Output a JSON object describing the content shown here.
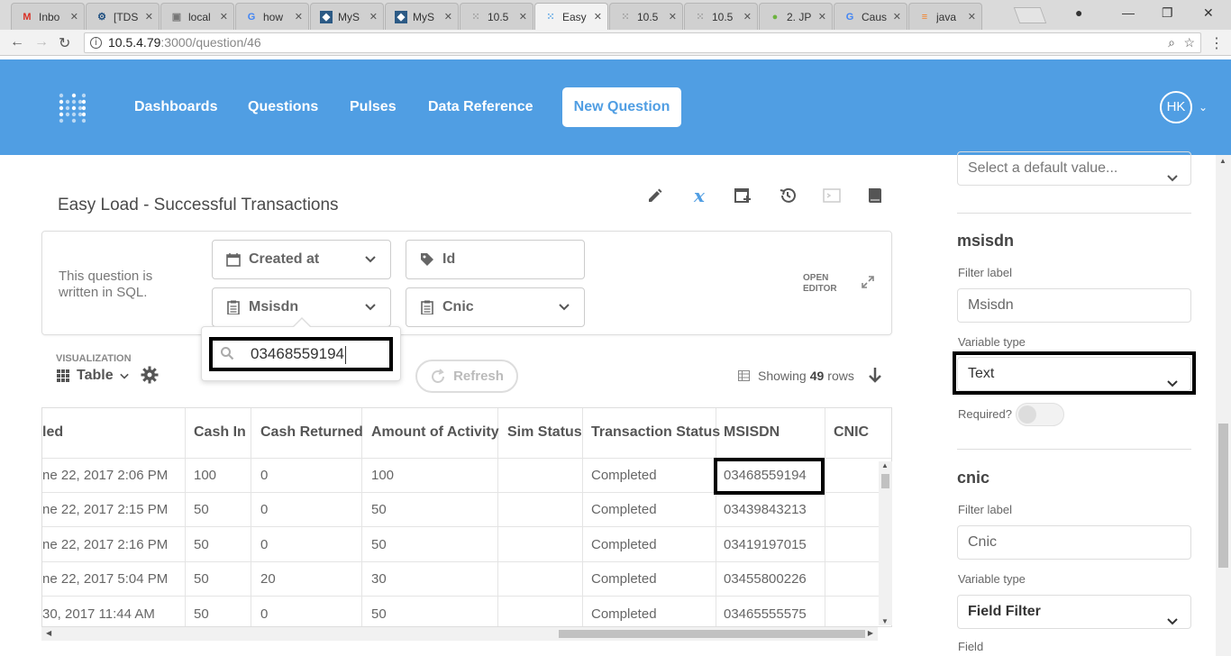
{
  "browser": {
    "tabs": [
      {
        "label": "Inbo",
        "icon": "gmail-icon"
      },
      {
        "label": "[TDS",
        "icon": "jira-icon"
      },
      {
        "label": "local",
        "icon": "xampp-icon"
      },
      {
        "label": "how",
        "icon": "google-icon"
      },
      {
        "label": "MyS",
        "icon": "mysql-icon"
      },
      {
        "label": "MyS",
        "icon": "mysql-icon"
      },
      {
        "label": "10.5",
        "icon": "metabase-icon"
      },
      {
        "label": "Easy",
        "icon": "metabase-icon"
      },
      {
        "label": "10.5",
        "icon": "metabase-icon"
      },
      {
        "label": "10.5",
        "icon": "metabase-icon"
      },
      {
        "label": "2. JP",
        "icon": "spring-icon"
      },
      {
        "label": "Caus",
        "icon": "google-icon"
      },
      {
        "label": "java",
        "icon": "stackoverflow-icon"
      }
    ],
    "url_host": "10.5.4.79",
    "url_path": ":3000/question/46"
  },
  "nav": {
    "links": [
      "Dashboards",
      "Questions",
      "Pulses",
      "Data Reference"
    ],
    "new_question": "New Question",
    "avatar_initials": "HK",
    "brand_color": "#509ee3"
  },
  "question": {
    "title": "Easy Load - Successful Transactions",
    "sql_note": "This question is written in SQL.",
    "open_editor": "OPEN EDITOR"
  },
  "filters": {
    "created_at": "Created at",
    "id": "Id",
    "msisdn": "Msisdn",
    "cnic": "Cnic"
  },
  "popover": {
    "value": "03468559194"
  },
  "viz": {
    "label": "VISUALIZATION",
    "type": "Table",
    "refresh": "Refresh",
    "showing_prefix": "Showing",
    "showing_count": "49",
    "showing_suffix": "rows"
  },
  "table": {
    "headers": [
      "led",
      "Cash In",
      "Cash Returned",
      "Amount of Activity",
      "Sim Status",
      "Transaction Status",
      "MSISDN",
      "CNIC"
    ],
    "rows": [
      [
        "ne 22, 2017 2:06 PM",
        "100",
        "0",
        "100",
        "",
        "Completed",
        "03468559194",
        ""
      ],
      [
        "ne 22, 2017 2:15 PM",
        "50",
        "0",
        "50",
        "",
        "Completed",
        "03439843213",
        ""
      ],
      [
        "ne 22, 2017 2:16 PM",
        "50",
        "0",
        "50",
        "",
        "Completed",
        "03419197015",
        ""
      ],
      [
        "ne 22, 2017 5:04 PM",
        "50",
        "20",
        "30",
        "",
        "Completed",
        "03455800226",
        ""
      ],
      [
        "30, 2017 11:44 AM",
        "50",
        "0",
        "50",
        "",
        "Completed",
        "03465555575",
        ""
      ]
    ]
  },
  "sidebar": {
    "default_value_placeholder": "Select a default value...",
    "msisdn": {
      "heading": "msisdn",
      "filter_label": "Filter label",
      "filter_value": "Msisdn",
      "variable_type_label": "Variable type",
      "variable_type": "Text",
      "required_label": "Required?"
    },
    "cnic": {
      "heading": "cnic",
      "filter_label": "Filter label",
      "filter_value": "Cnic",
      "variable_type_label": "Variable type",
      "variable_type": "Field Filter",
      "field_label": "Field"
    }
  }
}
